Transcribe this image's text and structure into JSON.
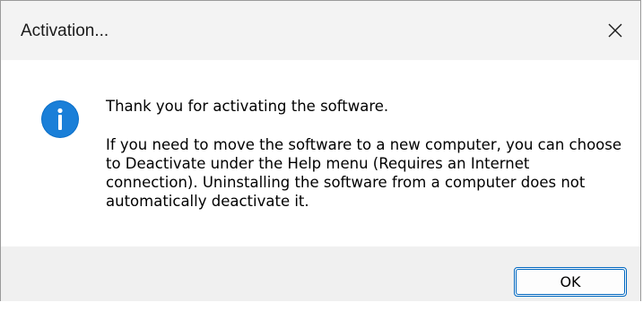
{
  "window": {
    "title": "Activation...",
    "close_icon": "close-icon"
  },
  "message": {
    "icon": "info-icon",
    "icon_color": "#0078d4",
    "line1": "Thank you for activating the software.",
    "line2": "If you need to move the software to a new computer, you can choose to Deactivate under the Help menu (Requires an Internet connection). Uninstalling the software from a computer does not automatically deactivate it."
  },
  "buttons": {
    "ok_label": "OK"
  }
}
